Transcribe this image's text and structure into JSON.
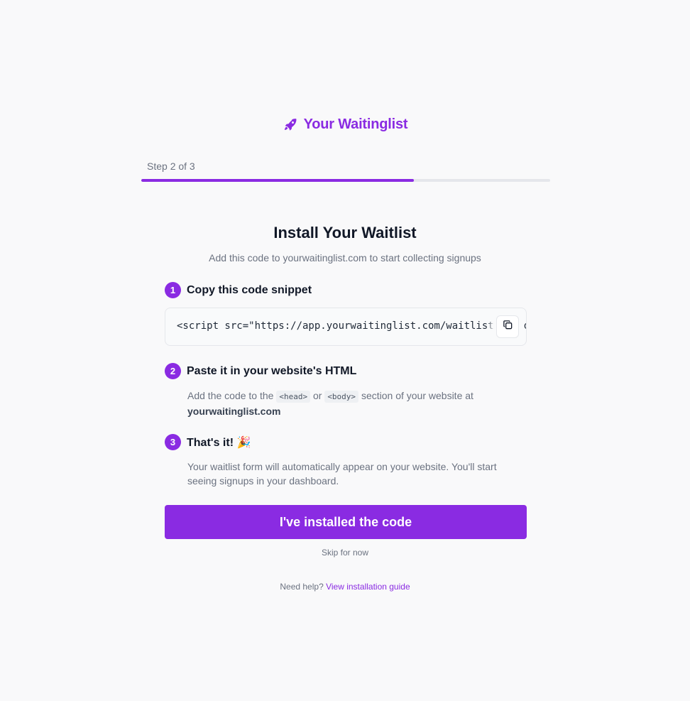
{
  "brand": {
    "name": "Your Waitinglist",
    "icon": "rocket-icon",
    "color": "#8a2be2"
  },
  "progress": {
    "label": "Step 2 of 3",
    "fraction": 0.667
  },
  "header": {
    "title": "Install Your Waitlist",
    "subtitle": "Add this code to yourwaitinglist.com to start collecting signups"
  },
  "steps": [
    {
      "number": "1",
      "title": "Copy this code snippet",
      "code": "<script src=\"https://app.yourwaitinglist.com/waitlist.js\" data-id=\"",
      "copy_icon": "copy-icon"
    },
    {
      "number": "2",
      "title": "Paste it in your website's HTML",
      "desc_prefix": "Add the code to the",
      "code_head": "<head>",
      "desc_or": "or",
      "code_body": "<body>",
      "desc_suffix": "section of your website at",
      "domain": "yourwaitinglist.com"
    },
    {
      "number": "3",
      "title": "That's it! 🎉",
      "desc": "Your waitlist form will automatically appear on your website. You'll start seeing signups in your dashboard."
    }
  ],
  "cta": {
    "label": "I've installed the code"
  },
  "skip": {
    "label": "Skip for now"
  },
  "help": {
    "prefix": "Need help?",
    "link": "View installation guide"
  }
}
